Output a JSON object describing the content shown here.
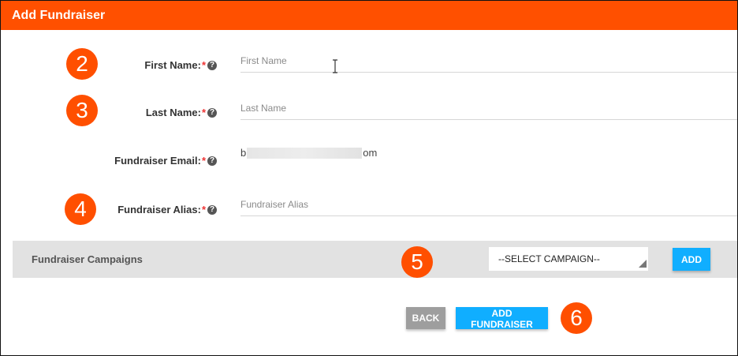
{
  "window": {
    "title": "Add Fundraiser"
  },
  "colors": {
    "header": "#ff5000",
    "badge": "#ff4f00",
    "accent": "#10aeff",
    "required": "#e33333"
  },
  "steps": {
    "first": "2",
    "last": "3",
    "alias": "4",
    "campaign": "5",
    "submit": "6"
  },
  "form": {
    "first_name": {
      "label": "First Name:",
      "required": "*",
      "help": "?",
      "value": "",
      "placeholder": "First Name"
    },
    "last_name": {
      "label": "Last Name:",
      "required": "*",
      "help": "?",
      "value": "",
      "placeholder": "Last Name"
    },
    "email": {
      "label": "Fundraiser Email:",
      "required": "*",
      "help": "?",
      "prefix": "b",
      "suffix": "om"
    },
    "alias": {
      "label": "Fundraiser Alias:",
      "required": "*",
      "help": "?",
      "value": "",
      "placeholder": "Fundraiser Alias"
    }
  },
  "campaigns": {
    "title": "Fundraiser Campaigns",
    "select_value": "--SELECT CAMPAIGN--",
    "add_label": "ADD"
  },
  "actions": {
    "back_label": "BACK",
    "submit_label": "ADD FUNDRAISER"
  },
  "icons": {
    "help": "question-circle-icon",
    "caret": "dropdown-caret-icon",
    "cursor": "text-cursor-icon"
  }
}
